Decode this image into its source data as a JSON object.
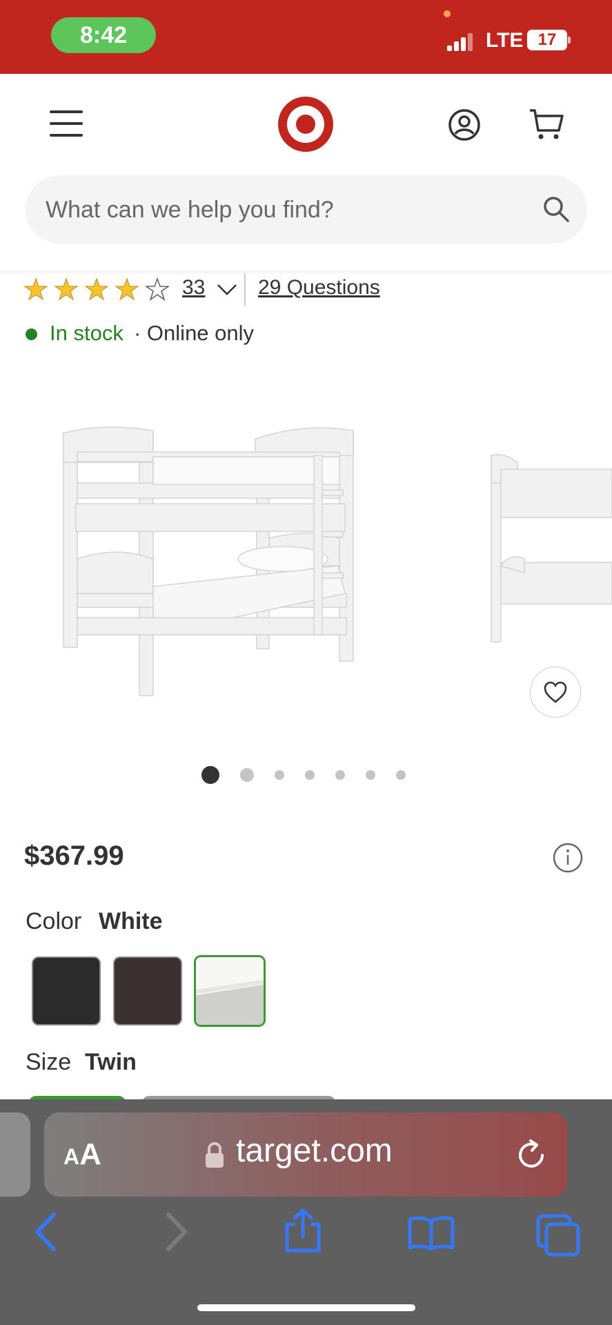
{
  "status_bar": {
    "time": "8:42",
    "network": "LTE",
    "battery": "17"
  },
  "header": {
    "search_placeholder": "What can we help you find?"
  },
  "product": {
    "rating_count": "33",
    "questions": "29 Questions",
    "stock": "In stock",
    "availability": "· Online only",
    "rating_stars": 4,
    "price": "$367.99",
    "color_label": "Color",
    "color_value": "White",
    "size_label": "Size",
    "size_value": "Twin",
    "gallery_current_index": 1,
    "gallery_count": 7
  },
  "browser": {
    "aa_label_big": "A",
    "aa_label_small": "A",
    "url": "target.com"
  },
  "colors": {
    "target_red": "#c0261d",
    "stock_green": "#238321",
    "swatch_selected": "#3a9b32",
    "toolbar_blue": "#3478f6"
  }
}
